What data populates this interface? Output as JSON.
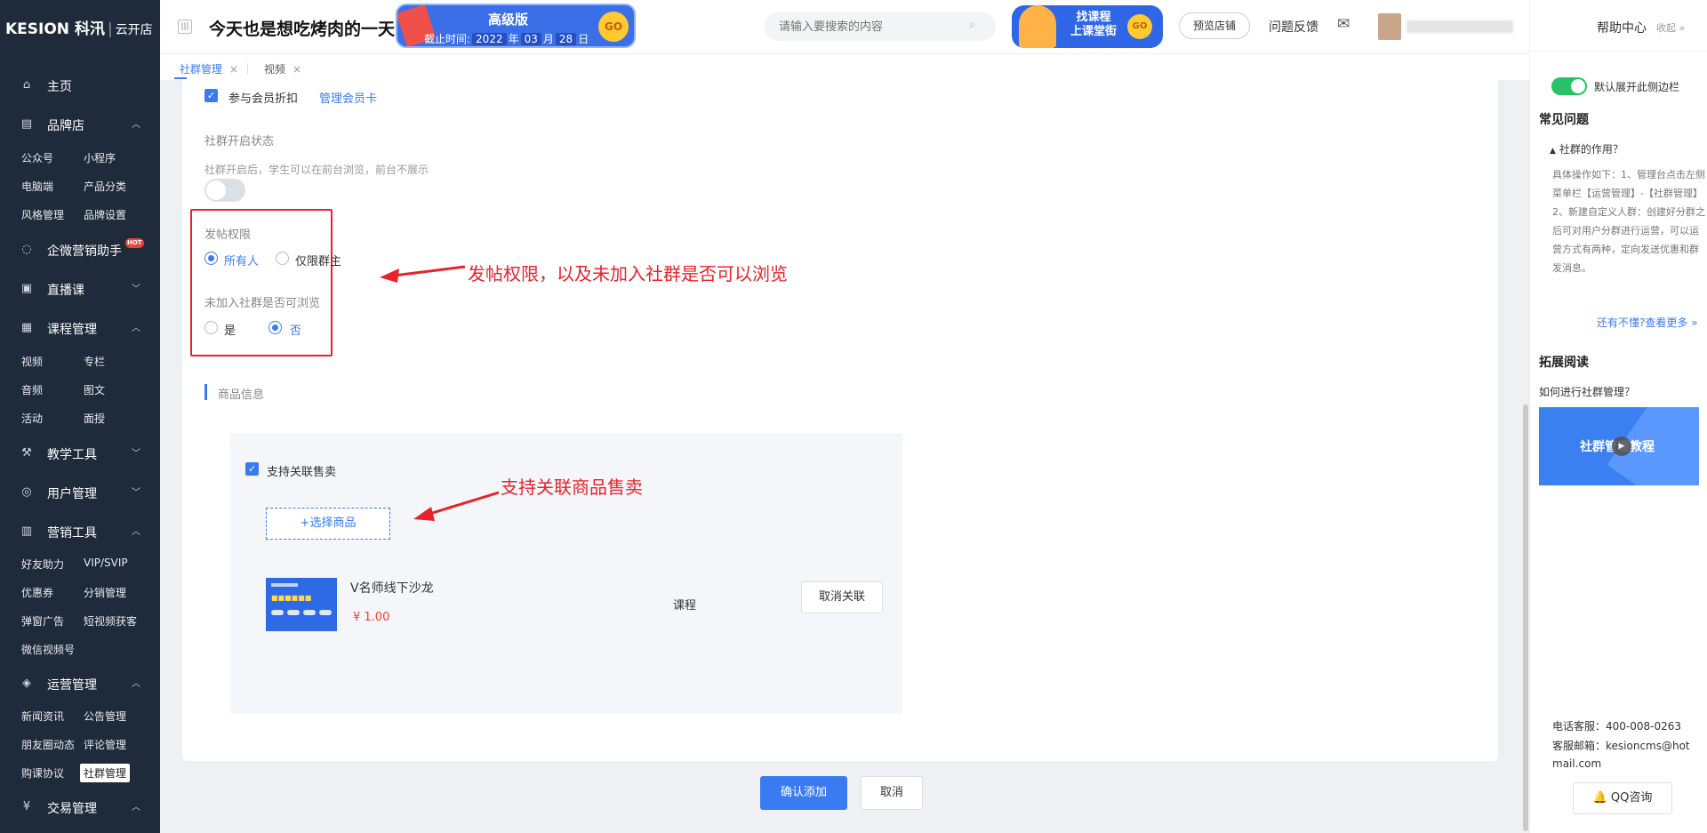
{
  "brand": {
    "logo": "KESION 科汛",
    "sub": "云开店"
  },
  "sidebar": {
    "home": "主页",
    "brand_store": {
      "label": "品牌店",
      "items": [
        "公众号",
        "小程序",
        "电脑端",
        "产品分类",
        "风格管理",
        "品牌设置"
      ]
    },
    "wecom": {
      "label": "企微营销助手",
      "badge": "HOT"
    },
    "live": {
      "label": "直播课"
    },
    "course": {
      "label": "课程管理",
      "items": [
        "视频",
        "专栏",
        "音频",
        "图文",
        "活动",
        "面授"
      ]
    },
    "teaching": {
      "label": "教学工具"
    },
    "users": {
      "label": "用户管理"
    },
    "marketing": {
      "label": "营销工具",
      "items": [
        "好友助力",
        "VIP/SVIP",
        "优惠券",
        "分销管理",
        "弹窗广告",
        "短视频获客",
        "微信视频号"
      ]
    },
    "operation": {
      "label": "运营管理",
      "items": [
        "新闻资讯",
        "公告管理",
        "朋友圈动态",
        "评论管理",
        "购课协议",
        "社群管理"
      ]
    },
    "trade": {
      "label": "交易管理"
    }
  },
  "header": {
    "title": "今天也是想吃烤肉的一天",
    "promo": {
      "title": "高级版",
      "deadline_label": "截止时间:",
      "year": "2022",
      "year_unit": "年",
      "month": "03",
      "month_unit": "月",
      "day": "28",
      "day_unit": "日",
      "go": "GO"
    },
    "search_placeholder": "请输入要搜索的内容",
    "promo2": {
      "line1": "找课程",
      "line2": "上课堂街",
      "go": "GO"
    },
    "preview": "预览店铺",
    "feedback": "问题反馈"
  },
  "tabs": [
    {
      "label": "社群管理",
      "close": "×"
    },
    {
      "label": "视频",
      "close": "×"
    }
  ],
  "form": {
    "member_discount": "参与会员折扣",
    "manage_card": "管理会员卡",
    "status_label": "社群开启状态",
    "status_hint": "社群开启后，学生可以在前台浏览，前台不展示",
    "post_perm_label": "发帖权限",
    "post_perm_options": [
      "所有人",
      "仅限群主"
    ],
    "browse_label": "未加入社群是否可浏览",
    "browse_options": [
      "是",
      "否"
    ],
    "annot1": "发帖权限，以及未加入社群是否可以浏览",
    "goods_section": "商品信息",
    "support_sale": "支持关联售卖",
    "select_goods": "+选择商品",
    "annot2": "支持关联商品售卖",
    "product": {
      "name": "V名师线下沙龙",
      "price": "¥ 1.00",
      "type": "课程",
      "unlink": "取消关联"
    },
    "confirm": "确认添加",
    "cancel": "取消"
  },
  "help": {
    "title": "帮助中心",
    "collapse": "收起",
    "default_open": "默认展开此侧边栏",
    "faq_title": "常见问题",
    "faq_q": "社群的作用？",
    "faq_a": "具体操作如下：1、管理台点击左侧菜单栏【运营管理】-【社群管理】2、新建自定义人群：创建好分群之后可对用户分群进行运营，可以运营方式有两种，定向发送优惠和群发消息。",
    "more": "还有不懂?查看更多",
    "ext_title": "拓展阅读",
    "ext_q": "如何进行社群管理？",
    "video_text": "社群管理教程",
    "phone": "电话客服：400-008-0263",
    "email": "客服邮箱：kesioncms@hotmail.com",
    "qq": "QQ咨询"
  },
  "colors": {
    "sidebar_bg": "#1f2b3a",
    "accent": "#3a7bf2",
    "annotation": "#e8222a",
    "toggle_on": "#27c265"
  }
}
